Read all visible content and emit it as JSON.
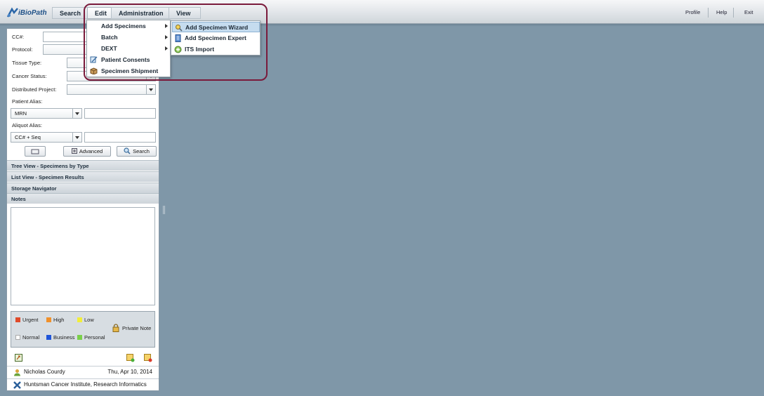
{
  "app": {
    "logo_text": "iBioPath"
  },
  "menubar": {
    "search": "Search",
    "edit": "Edit",
    "administration": "Administration",
    "view": "View",
    "profile": "Profile",
    "help": "Help",
    "exit": "Exit"
  },
  "edit_menu": {
    "items": [
      {
        "label": "Add Specimens",
        "has_submenu": true
      },
      {
        "label": "Batch",
        "has_submenu": true
      },
      {
        "label": "DEXT",
        "has_submenu": true
      },
      {
        "label": "Patient Consents",
        "icon": "consent-icon"
      },
      {
        "label": "Specimen Shipment",
        "icon": "box-icon"
      }
    ]
  },
  "add_specimens_submenu": {
    "items": [
      {
        "label": "Add Specimen Wizard",
        "icon": "wizard-icon",
        "active": true
      },
      {
        "label": "Add Specimen Expert",
        "icon": "document-icon"
      },
      {
        "label": "ITS Import",
        "icon": "import-icon"
      }
    ]
  },
  "search_form": {
    "cc_label": "CC#:",
    "protocol_label": "Protocol:",
    "tissue_type_label": "Tissue Type:",
    "cancer_status_label": "Cancer Status:",
    "distributed_project_label": "Distributed Project:",
    "patient_alias_label": "Patient Alias:",
    "patient_alias_type": "MRN",
    "aliquot_alias_label": "Aliquot Alias:",
    "aliquot_alias_type": "CC# + Seq",
    "advanced_button": "Advanced",
    "search_button": "Search"
  },
  "accordion": {
    "tree_view": "Tree View - Specimens by Type",
    "list_view": "List View - Specimen Results",
    "storage_navigator": "Storage Navigator",
    "notes": "Notes"
  },
  "notes_legend": {
    "urgent": "Urgent",
    "high": "High",
    "low": "Low",
    "normal": "Normal",
    "business": "Business",
    "personal": "Personal",
    "private_note": "Private Note",
    "colors": {
      "urgent": "#e04a2a",
      "high": "#f0902a",
      "low": "#f2ee3a",
      "normal": "#ffffff",
      "business": "#1f55d9",
      "personal": "#7ad04a"
    }
  },
  "footer": {
    "user_name": "Nicholas Courdy",
    "date": "Thu, Apr 10, 2014",
    "institution": "Huntsman Cancer Institute, Research Informatics"
  }
}
